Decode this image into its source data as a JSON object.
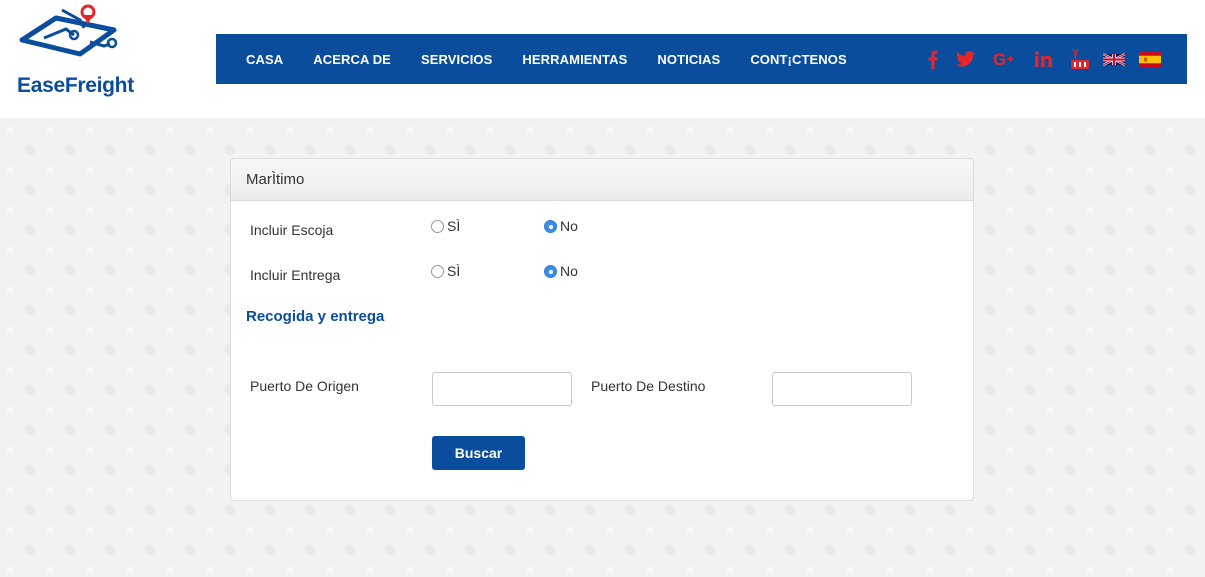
{
  "brand": {
    "name": "EaseFreight",
    "color": "#0a4d9c",
    "pin_color": "#e3262c"
  },
  "nav": {
    "items": [
      {
        "label": "CASA"
      },
      {
        "label": "ACERCA DE"
      },
      {
        "label": "SERVICIOS"
      },
      {
        "label": "HERRAMIENTAS"
      },
      {
        "label": "NOTICIAS"
      },
      {
        "label": "CONT¡CTENOS"
      }
    ],
    "social": [
      "facebook-icon",
      "twitter-icon",
      "google-plus-icon",
      "linkedin-icon",
      "youtube-icon"
    ],
    "languages": [
      "english-flag",
      "spanish-flag"
    ]
  },
  "panel": {
    "title": "MarÌtimo",
    "escoja": {
      "label": "Incluir Escoja",
      "options": [
        "SÌ",
        "No"
      ],
      "selected": "No"
    },
    "entrega": {
      "label": "Incluir Entrega",
      "options": [
        "SÌ",
        "No"
      ],
      "selected": "No"
    },
    "section_heading": "Recogida y entrega",
    "origin": {
      "label": "Puerto De Origen",
      "value": "",
      "placeholder": ""
    },
    "destination": {
      "label": "Puerto De Destino",
      "value": "",
      "placeholder": ""
    },
    "search_button": "Buscar"
  }
}
